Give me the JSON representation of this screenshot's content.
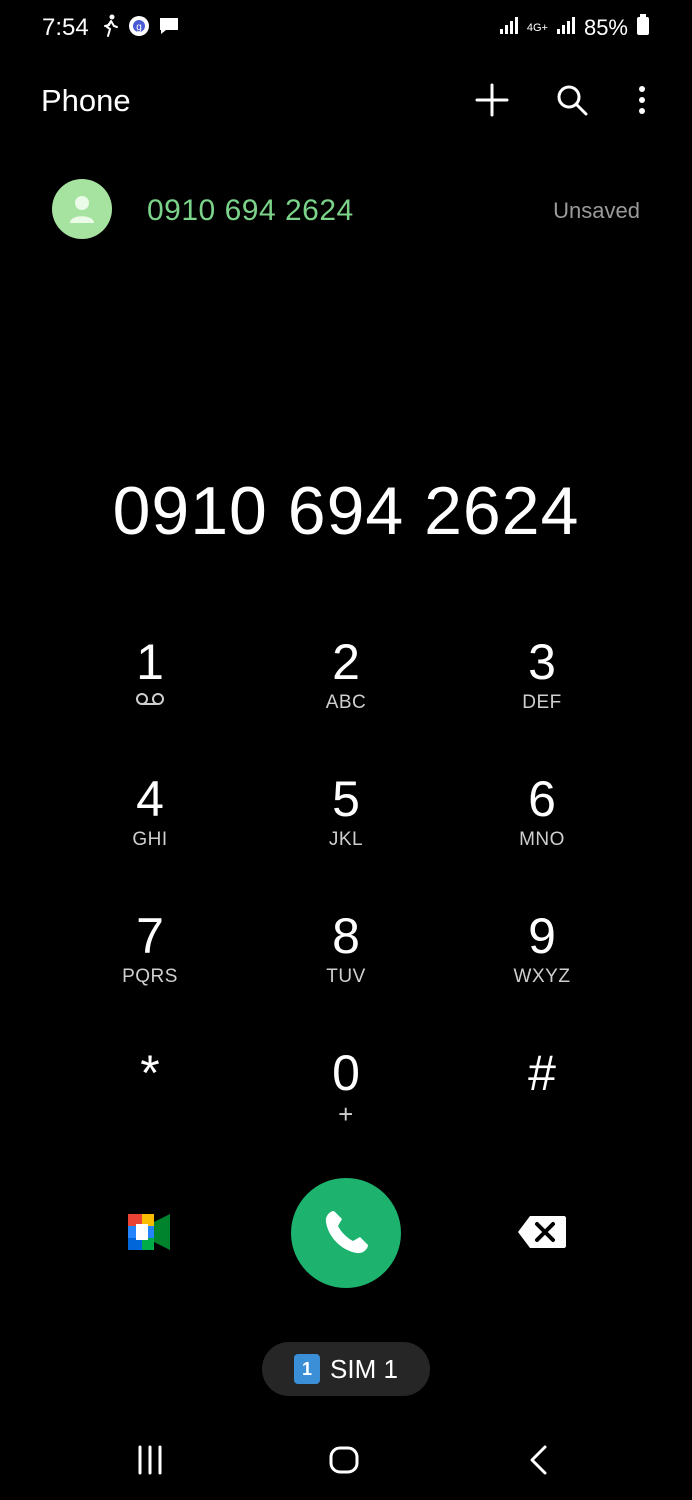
{
  "status_bar": {
    "time": "7:54",
    "battery": "85%",
    "network": "4G+"
  },
  "header": {
    "title": "Phone"
  },
  "suggestion": {
    "number": "0910 694 2624",
    "status": "Unsaved"
  },
  "dialed_number": "0910 694 2624",
  "keypad": [
    {
      "digit": "1",
      "letters": ""
    },
    {
      "digit": "2",
      "letters": "ABC"
    },
    {
      "digit": "3",
      "letters": "DEF"
    },
    {
      "digit": "4",
      "letters": "GHI"
    },
    {
      "digit": "5",
      "letters": "JKL"
    },
    {
      "digit": "6",
      "letters": "MNO"
    },
    {
      "digit": "7",
      "letters": "PQRS"
    },
    {
      "digit": "8",
      "letters": "TUV"
    },
    {
      "digit": "9",
      "letters": "WXYZ"
    },
    {
      "digit": "*",
      "letters": ""
    },
    {
      "digit": "0",
      "letters": "+"
    },
    {
      "digit": "#",
      "letters": ""
    }
  ],
  "sim": {
    "badge": "1",
    "label": "SIM 1"
  },
  "colors": {
    "accent_green": "#1db36e",
    "number_green": "#7bd38a",
    "avatar_bg": "#a7e3a0",
    "sim_blue": "#3a8fd6"
  }
}
